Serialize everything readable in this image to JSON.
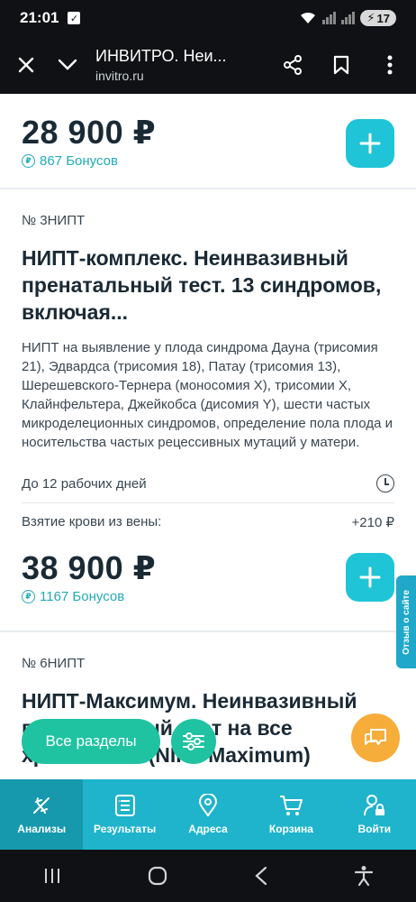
{
  "status_bar": {
    "time": "21:01",
    "battery": "17"
  },
  "browser": {
    "title": "ИНВИТРО. Неи...",
    "url": "invitro.ru"
  },
  "products": [
    {
      "price": "28 900 ₽",
      "bonus": "867 Бонусов"
    },
    {
      "code": "№ 3НИПТ",
      "title": "НИПТ-комплекс. Неинвазивный пренатальный тест. 13 синдромов, включая...",
      "description": "НИПТ на выявление у плода синдрома Дауна (трисомия 21), Эдвардса (трисомия 18), Патау (трисомия 13), Шерешевского-Тернера (моносомия Х), трисомии Х, Клайнфельтера, Джейкобса (дисомия Y), шести частых микроделеционных синдромов, определение пола плода и носительства частых рецессивных мутаций у матери.",
      "duration": "До 12 рабочих дней",
      "extra_label": "Взятие крови из вены:",
      "extra_price": "+210 ₽",
      "price": "38 900 ₽",
      "bonus": "1167 Бонусов"
    },
    {
      "code": "№ 6НИПТ",
      "title": "НИПТ-Максимум. Неинвазивный пренатальный тест на все хромосомы (NIPT Maximum)"
    }
  ],
  "side_tab": {
    "label": "Отзыв о сайте"
  },
  "floating": {
    "sections_label": "Все разделы"
  },
  "tabbar": {
    "items": [
      {
        "label": "Анализы",
        "icon": "dna-icon"
      },
      {
        "label": "Результаты",
        "icon": "results-icon"
      },
      {
        "label": "Адреса",
        "icon": "location-icon"
      },
      {
        "label": "Корзина",
        "icon": "cart-icon"
      },
      {
        "label": "Войти",
        "icon": "user-lock-icon"
      }
    ]
  },
  "colors": {
    "accent": "#1fc4d6",
    "tabbar": "#1fb4cc",
    "green": "#1fc3a1",
    "chat": "#f6ad3a"
  }
}
